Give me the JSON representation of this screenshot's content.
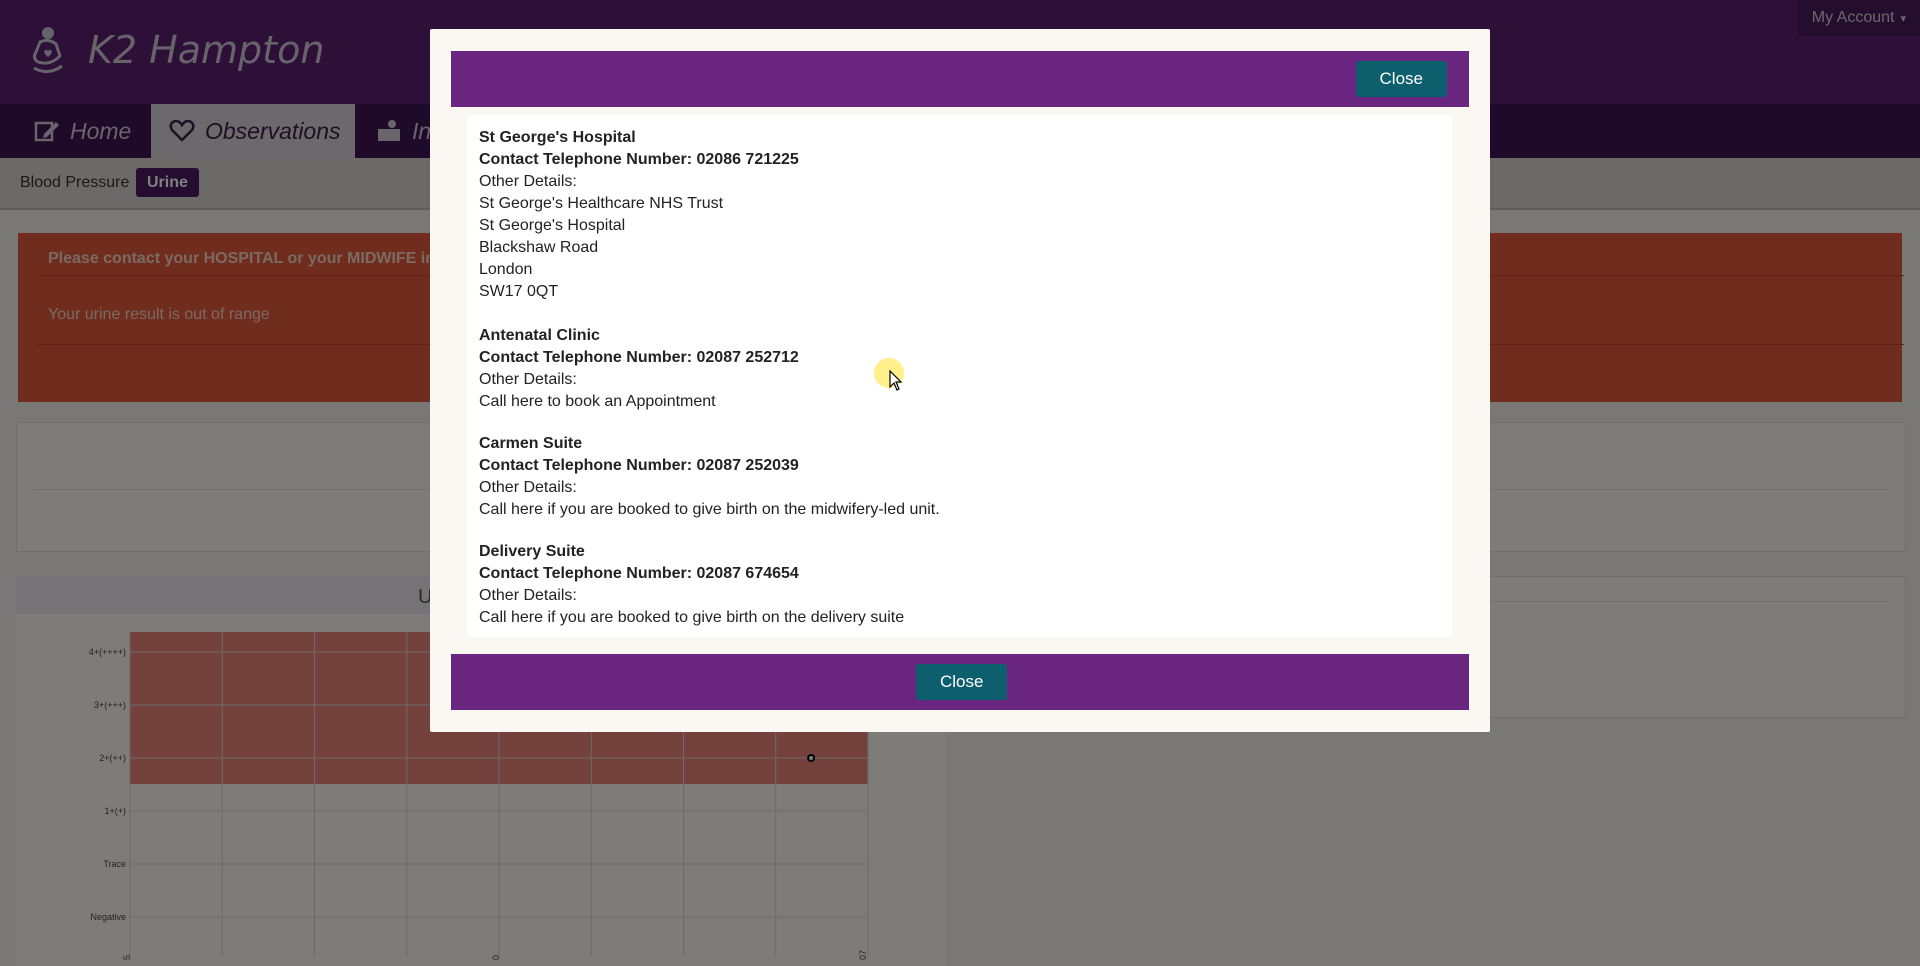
{
  "header": {
    "brand_title": "K2 Hampton",
    "logo_icon": "mother-baby-heart-icon",
    "account_label": "My Account",
    "account_caret": "▾"
  },
  "nav": {
    "tabs": [
      {
        "label": "Home",
        "icon": "edit-icon",
        "active": false
      },
      {
        "label": "Observations",
        "icon": "heart-outline-icon",
        "active": true
      },
      {
        "label": "In",
        "icon": "info-person-icon",
        "active": false
      }
    ]
  },
  "subnav": {
    "items": [
      {
        "label": "Blood Pressure",
        "active": false
      },
      {
        "label": "Urine",
        "active": true
      }
    ]
  },
  "alert": {
    "heading": "Please contact your HOSPITAL or your MIDWIFE imm",
    "message": "Your urine result is out of range"
  },
  "chart_data": {
    "type": "scatter",
    "title": "U",
    "y_ticks": [
      "4+(++++)",
      "3+(+++)",
      "2+(++)",
      "1+(+)",
      "Trace",
      "Negative"
    ],
    "x_ticks": [
      "5",
      "0",
      "07"
    ],
    "points": [
      {
        "x": 7.6,
        "y": "2+(++)"
      }
    ],
    "shaded_range": [
      "2+(++)",
      "4+(++++)"
    ],
    "colors": {
      "shaded": "#e8837a",
      "grid": "#d9d4cf"
    }
  },
  "modal": {
    "close_top_label": "Close",
    "close_bottom_label": "Close",
    "entries": [
      {
        "name": "St George's Hospital",
        "phone": "Contact Telephone Number: 02086 721225",
        "details_label": "Other Details:",
        "details": [
          "St George's Healthcare NHS Trust",
          "St George's Hospital",
          "Blackshaw Road",
          "London",
          "SW17 0QT"
        ]
      },
      {
        "name": "Antenatal Clinic",
        "phone": "Contact Telephone Number: 02087 252712",
        "details_label": "Other Details:",
        "details": [
          "Call here to book an Appointment"
        ]
      },
      {
        "name": "Carmen Suite",
        "phone": "Contact Telephone Number: 02087 252039",
        "details_label": "Other Details:",
        "details": [
          "Call here if you are booked to give birth on the midwifery-led unit."
        ]
      },
      {
        "name": "Delivery Suite",
        "phone": "Contact Telephone Number: 02087 674654",
        "details_label": "Other Details:",
        "details": [
          "Call here if you are booked to give birth on the delivery suite"
        ]
      }
    ]
  },
  "colors": {
    "header_bg": "#5b1f6f",
    "modal_bar": "#6a2581",
    "button_teal": "#0e5f6e",
    "alert_red": "#e05a3a"
  }
}
